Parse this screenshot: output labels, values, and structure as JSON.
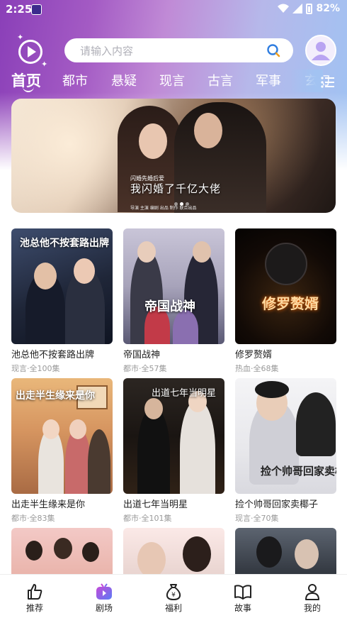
{
  "status_bar": {
    "time": "2:25",
    "battery": "82%"
  },
  "search": {
    "placeholder": "请输入内容"
  },
  "tabs": [
    {
      "label": "首页",
      "active": true
    },
    {
      "label": "都市"
    },
    {
      "label": "悬疑"
    },
    {
      "label": "现言"
    },
    {
      "label": "古言"
    },
    {
      "label": "军事"
    },
    {
      "label": "玄幻"
    }
  ],
  "banner": {
    "headline": "我闪婚了千亿大佬",
    "tagline": "闪婚先婚后爱",
    "credits": "导演 主演 编剧 出品 制作 联合出品",
    "dots": 3,
    "active_dot": 1
  },
  "dramas": [
    {
      "title": "池总他不按套路出牌",
      "meta": "现言·全100集",
      "poster_text": "池总他不按套路出牌"
    },
    {
      "title": "帝国战神",
      "meta": "都市·全57集",
      "poster_text": "帝国战神"
    },
    {
      "title": "修罗赘婿",
      "meta": "热血·全68集",
      "poster_text": "修罗赘婿"
    },
    {
      "title": "出走半生缘来是你",
      "meta": "都市·全83集",
      "poster_text": "出走半生缘来是你"
    },
    {
      "title": "出道七年当明星",
      "meta": "都市·全101集",
      "poster_text": "出道七年当明星"
    },
    {
      "title": "捡个帅哥回家卖椰子",
      "meta": "现言·全70集",
      "poster_text": "捡个帅哥回家卖椰子"
    }
  ],
  "bottom_nav": [
    {
      "label": "推荐",
      "icon": "thumbs-up-icon"
    },
    {
      "label": "剧场",
      "icon": "tv-icon",
      "active": true
    },
    {
      "label": "福利",
      "icon": "money-bag-icon"
    },
    {
      "label": "故事",
      "icon": "book-icon"
    },
    {
      "label": "我的",
      "icon": "person-icon"
    }
  ],
  "colors": {
    "accent": "#7b5cf0",
    "header_start": "#8a3fb8",
    "header_end": "#9fc3f3"
  }
}
